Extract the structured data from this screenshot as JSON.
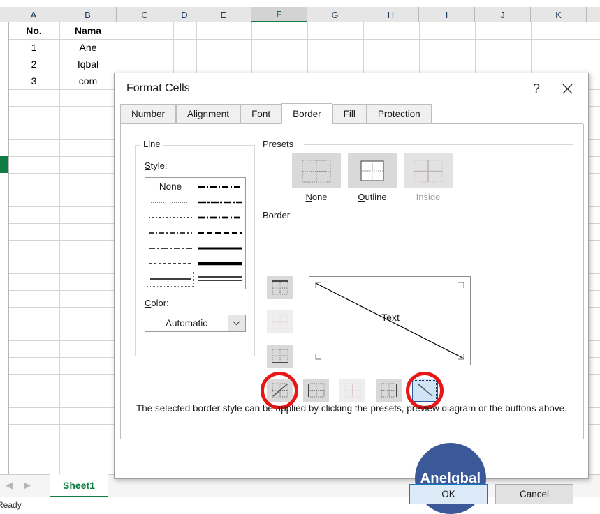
{
  "spreadsheet": {
    "columns": [
      "A",
      "B",
      "C",
      "D",
      "E",
      "F",
      "G",
      "H",
      "I",
      "J",
      "K"
    ],
    "selected_column": "F",
    "header_row": {
      "a": "No.",
      "b": "Nama"
    },
    "rows": [
      {
        "no": "1",
        "nama": "Ane"
      },
      {
        "no": "2",
        "nama": "Iqbal"
      },
      {
        "no": "3",
        "nama": "com"
      }
    ],
    "sheet_tab": "Sheet1",
    "status": "Ready",
    "nav_prev_icon": "triangle-left-icon",
    "nav_next_icon": "triangle-right-icon"
  },
  "dialog": {
    "title": "Format Cells",
    "help_icon": "question-mark-icon",
    "close_icon": "close-x-icon",
    "tabs": [
      {
        "label": "Number",
        "active": false
      },
      {
        "label": "Alignment",
        "active": false
      },
      {
        "label": "Font",
        "active": false
      },
      {
        "label": "Border",
        "active": true
      },
      {
        "label": "Fill",
        "active": false
      },
      {
        "label": "Protection",
        "active": false
      }
    ],
    "line_group": {
      "legend": "Line",
      "style_label": "Style:",
      "none_option": "None",
      "selected_style": "thin-solid",
      "color_label": "Color:",
      "color_value": "Automatic",
      "color_dropdown_icon": "chevron-down-icon"
    },
    "presets": {
      "legend": "Presets",
      "items": [
        {
          "label": "None",
          "name": "preset-none",
          "disabled": false
        },
        {
          "label": "Outline",
          "name": "preset-outline",
          "disabled": false
        },
        {
          "label": "Inside",
          "name": "preset-inside",
          "disabled": true
        }
      ]
    },
    "border": {
      "legend": "Border",
      "preview_text": "Text",
      "side_buttons": [
        {
          "name": "border-top-button",
          "disabled": false
        },
        {
          "name": "border-horizontal-inside-button",
          "disabled": true
        },
        {
          "name": "border-bottom-button",
          "disabled": false
        }
      ],
      "bottom_buttons": [
        {
          "name": "border-diagonal-up-button",
          "disabled": false,
          "active": false,
          "highlighted": true
        },
        {
          "name": "border-left-button",
          "disabled": false,
          "active": false,
          "highlighted": false
        },
        {
          "name": "border-vertical-inside-button",
          "disabled": true,
          "active": false,
          "highlighted": false
        },
        {
          "name": "border-right-button",
          "disabled": false,
          "active": false,
          "highlighted": false
        },
        {
          "name": "border-diagonal-down-button",
          "disabled": false,
          "active": true,
          "highlighted": true
        }
      ],
      "annotation_color": "#e81717"
    },
    "hint": "The selected border style can be applied by clicking the presets, preview diagram or the buttons above.",
    "watermark": "Anelqbal",
    "watermark_color": "#3b5998",
    "buttons": {
      "ok": "OK",
      "cancel": "Cancel"
    }
  }
}
